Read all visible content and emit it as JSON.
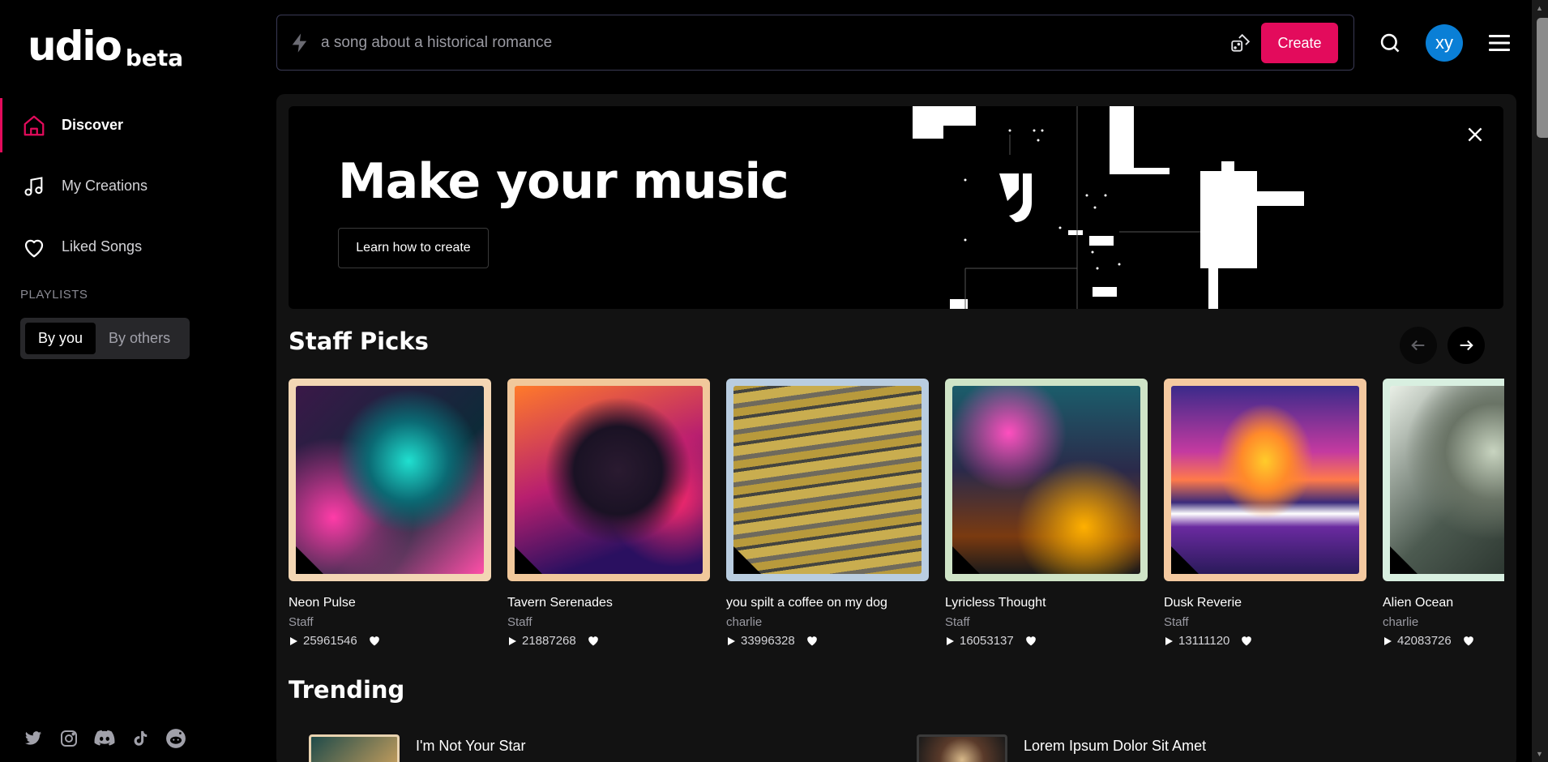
{
  "brand": {
    "name": "udio",
    "tag": "beta"
  },
  "sidebar": {
    "items": [
      {
        "label": "Discover",
        "icon": "home-icon",
        "active": true
      },
      {
        "label": "My Creations",
        "icon": "music-note-icon",
        "active": false
      },
      {
        "label": "Liked Songs",
        "icon": "heart-icon",
        "active": false
      }
    ],
    "playlists_label": "PLAYLISTS",
    "playlist_tabs": [
      {
        "label": "By you",
        "active": true
      },
      {
        "label": "By others",
        "active": false
      }
    ],
    "socials": [
      "twitter-icon",
      "instagram-icon",
      "discord-icon",
      "tiktok-icon",
      "reddit-icon"
    ]
  },
  "topbar": {
    "prompt_placeholder": "a song about a historical romance",
    "create_label": "Create",
    "avatar_initials": "xy"
  },
  "hero": {
    "title": "Make your music",
    "button_label": "Learn how to create"
  },
  "staff_picks": {
    "title": "Staff Picks",
    "cards": [
      {
        "title": "Neon Pulse",
        "author": "Staff",
        "plays": "25961546",
        "frame": "#f3d6b4"
      },
      {
        "title": "Tavern Serenades",
        "author": "Staff",
        "plays": "21887268",
        "frame": "#f1c89b"
      },
      {
        "title": "you spilt a coffee on my dog",
        "author": "charlie",
        "plays": "33996328",
        "frame": "#b9cde0"
      },
      {
        "title": "Lyricless Thought",
        "author": "Staff",
        "plays": "16053137",
        "frame": "#cfe4c7"
      },
      {
        "title": "Dusk Reverie",
        "author": "Staff",
        "plays": "13111120",
        "frame": "#f4c9a0"
      },
      {
        "title": "Alien Ocean",
        "author": "charlie",
        "plays": "42083726",
        "frame": "#d8efe0"
      }
    ]
  },
  "trending": {
    "title": "Trending",
    "items": [
      {
        "title": "I'm Not Your Star"
      },
      {
        "title": "Lorem Ipsum Dolor Sit Amet"
      }
    ]
  },
  "colors": {
    "accent": "#e30b5c",
    "avatar": "#0a7fd6",
    "panel": "#121212"
  }
}
